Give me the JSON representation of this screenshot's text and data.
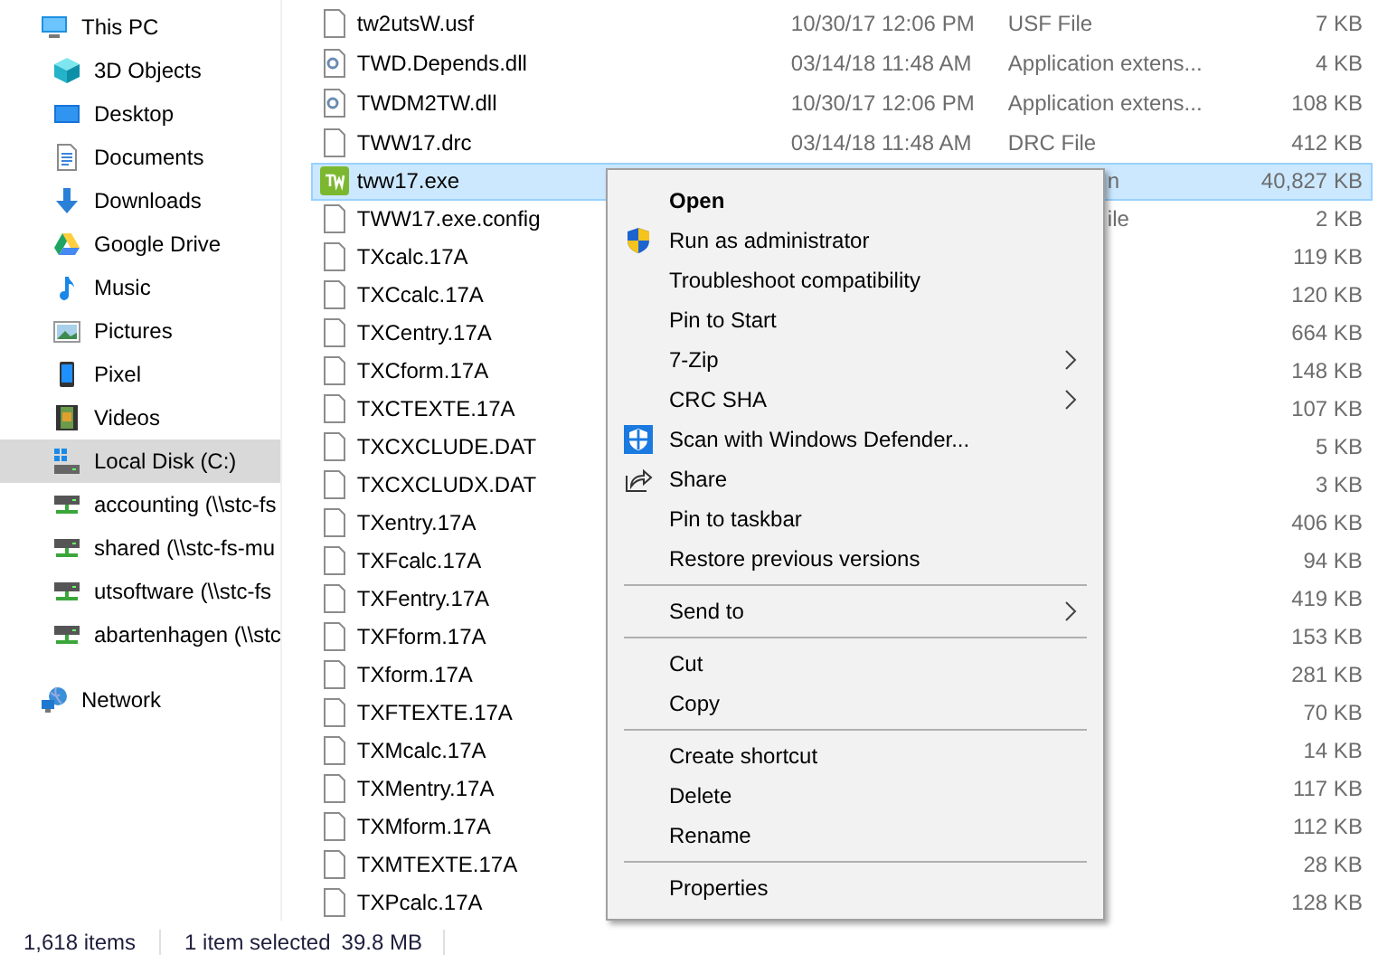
{
  "sidebar": {
    "items": [
      {
        "label": "This PC",
        "kind": "pc",
        "selected": false,
        "children": [
          {
            "label": "3D Objects",
            "kind": "cube",
            "selected": false
          },
          {
            "label": "Desktop",
            "kind": "desktop",
            "selected": false
          },
          {
            "label": "Documents",
            "kind": "document",
            "selected": false
          },
          {
            "label": "Downloads",
            "kind": "download",
            "selected": false
          },
          {
            "label": "Google Drive",
            "kind": "drive",
            "selected": false
          },
          {
            "label": "Music",
            "kind": "music",
            "selected": false
          },
          {
            "label": "Pictures",
            "kind": "pictures",
            "selected": false
          },
          {
            "label": "Pixel",
            "kind": "phone",
            "selected": false
          },
          {
            "label": "Videos",
            "kind": "videos",
            "selected": false
          },
          {
            "label": "Local Disk (C:)",
            "kind": "disk",
            "selected": true
          },
          {
            "label": "accounting (\\\\stc-fs",
            "kind": "netdrive",
            "selected": false
          },
          {
            "label": "shared (\\\\stc-fs-mu",
            "kind": "netdrive",
            "selected": false
          },
          {
            "label": "utsoftware (\\\\stc-fs",
            "kind": "netdrive",
            "selected": false
          },
          {
            "label": "abartenhagen (\\\\stc",
            "kind": "netdrive",
            "selected": false
          }
        ]
      },
      {
        "label": "Network",
        "kind": "network",
        "selected": false
      }
    ]
  },
  "files": [
    {
      "name": "tw2utsW.usf",
      "kind": "file",
      "date": "10/30/17 12:06 PM",
      "type": "USF File",
      "size": "7 KB",
      "selected": false
    },
    {
      "name": "TWD.Depends.dll",
      "kind": "dll",
      "date": "03/14/18 11:48 AM",
      "type": "Application extens...",
      "size": "4 KB",
      "selected": false
    },
    {
      "name": "TWDM2TW.dll",
      "kind": "dll",
      "date": "10/30/17 12:06 PM",
      "type": "Application extens...",
      "size": "108 KB",
      "selected": false
    },
    {
      "name": "TWW17.drc",
      "kind": "file",
      "date": "03/14/18 11:48 AM",
      "type": "DRC File",
      "size": "412 KB",
      "selected": false
    },
    {
      "name": "tww17.exe",
      "kind": "app",
      "type": "n",
      "size": "40,827 KB",
      "selected": true
    },
    {
      "name": "TWW17.exe.config",
      "kind": "file",
      "type": "ile",
      "size": "2 KB",
      "selected": false
    },
    {
      "name": "TXcalc.17A",
      "kind": "file",
      "size": "119 KB",
      "selected": false
    },
    {
      "name": "TXCcalc.17A",
      "kind": "file",
      "size": "120 KB",
      "selected": false
    },
    {
      "name": "TXCentry.17A",
      "kind": "file",
      "size": "664 KB",
      "selected": false
    },
    {
      "name": "TXCform.17A",
      "kind": "file",
      "size": "148 KB",
      "selected": false
    },
    {
      "name": "TXCTEXTE.17A",
      "kind": "file",
      "size": "107 KB",
      "selected": false
    },
    {
      "name": "TXCXCLUDE.DAT",
      "kind": "file",
      "size": "5 KB",
      "selected": false
    },
    {
      "name": "TXCXCLUDX.DAT",
      "kind": "file",
      "size": "3 KB",
      "selected": false
    },
    {
      "name": "TXentry.17A",
      "kind": "file",
      "size": "406 KB",
      "selected": false
    },
    {
      "name": "TXFcalc.17A",
      "kind": "file",
      "size": "94 KB",
      "selected": false
    },
    {
      "name": "TXFentry.17A",
      "kind": "file",
      "size": "419 KB",
      "selected": false
    },
    {
      "name": "TXFform.17A",
      "kind": "file",
      "size": "153 KB",
      "selected": false
    },
    {
      "name": "TXform.17A",
      "kind": "file",
      "size": "281 KB",
      "selected": false
    },
    {
      "name": "TXFTEXTE.17A",
      "kind": "file",
      "size": "70 KB",
      "selected": false
    },
    {
      "name": "TXMcalc.17A",
      "kind": "file",
      "size": "14 KB",
      "selected": false
    },
    {
      "name": "TXMentry.17A",
      "kind": "file",
      "size": "117 KB",
      "selected": false
    },
    {
      "name": "TXMform.17A",
      "kind": "file",
      "size": "112 KB",
      "selected": false
    },
    {
      "name": "TXMTEXTE.17A",
      "kind": "file",
      "size": "28 KB",
      "selected": false
    },
    {
      "name": "TXPcalc.17A",
      "kind": "file",
      "size": "128 KB",
      "selected": false
    }
  ],
  "context_menu": {
    "groups": [
      [
        {
          "label": "Open",
          "default": true
        },
        {
          "label": "Run as administrator",
          "kind": "shield"
        },
        {
          "label": "Troubleshoot compatibility"
        },
        {
          "label": "Pin to Start"
        },
        {
          "label": "7-Zip",
          "submenu": true
        },
        {
          "label": "CRC SHA",
          "submenu": true
        },
        {
          "label": "Scan with Windows Defender...",
          "kind": "defender"
        },
        {
          "label": "Share",
          "kind": "share"
        },
        {
          "label": "Pin to taskbar"
        },
        {
          "label": "Restore previous versions"
        }
      ],
      [
        {
          "label": "Send to",
          "submenu": true
        }
      ],
      [
        {
          "label": "Cut"
        },
        {
          "label": "Copy"
        }
      ],
      [
        {
          "label": "Create shortcut"
        },
        {
          "label": "Delete"
        },
        {
          "label": "Rename"
        }
      ],
      [
        {
          "label": "Properties"
        }
      ]
    ]
  },
  "status_bar": {
    "item_count": "1,618 items",
    "selection": "1 item selected",
    "selection_size": "39.8 MB"
  }
}
